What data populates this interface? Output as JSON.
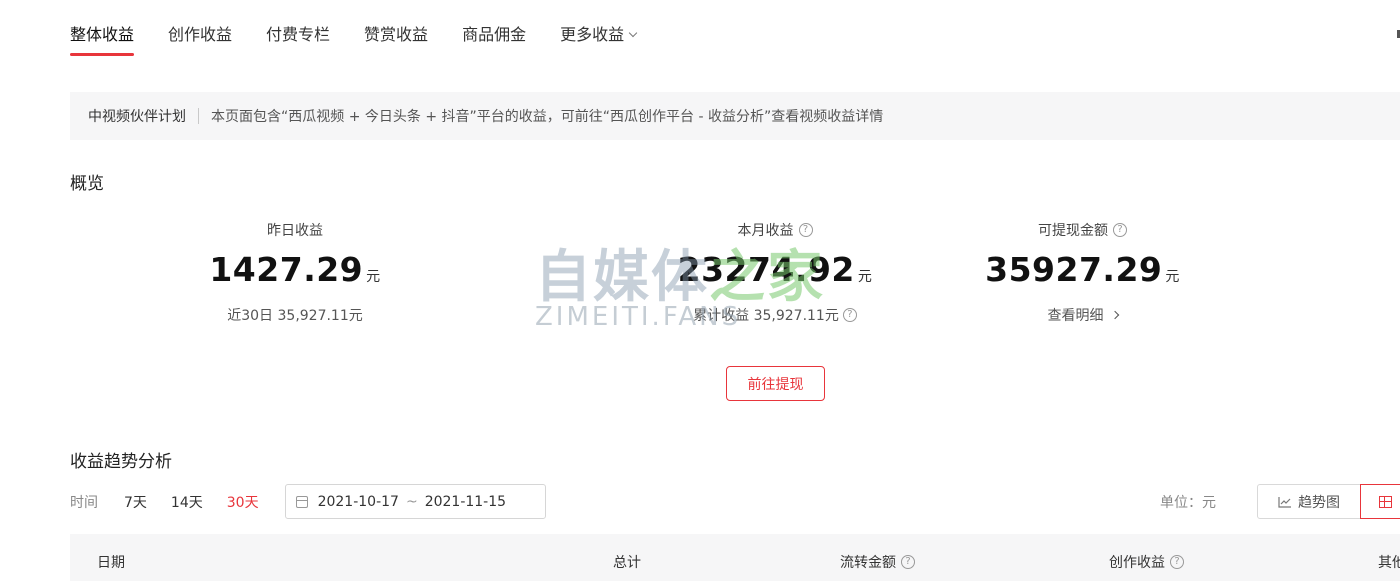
{
  "tabs": [
    "整体收益",
    "创作收益",
    "付费专栏",
    "赞赏收益",
    "商品佣金",
    "更多收益"
  ],
  "notice": {
    "tag": "中视频伙伴计划",
    "text": "本页面包含“西瓜视频 + 今日头条 + 抖音”平台的收益，可前往“西瓜创作平台 - 收益分析”查看视频收益详情"
  },
  "overview": {
    "title": "概览",
    "yesterday": {
      "label": "昨日收益",
      "value": "1427.29",
      "unit": "元",
      "sub": "近30日 35,927.11元"
    },
    "month": {
      "label": "本月收益",
      "value": "23274.92",
      "unit": "元",
      "sub": "累计收益 35,927.11元"
    },
    "withdrawable": {
      "label": "可提现金额",
      "value": "35927.29",
      "unit": "元",
      "sub": "查看明细"
    },
    "withdraw_button": "前往提现"
  },
  "watermark": {
    "main_a": "自媒体",
    "main_b": "之",
    "main_c": "家",
    "sub": "ZIMEITI.FANS"
  },
  "trend": {
    "title": "收益趋势分析",
    "time_label": "时间",
    "ranges": [
      "7天",
      "14天",
      "30天"
    ],
    "active_range": "30天",
    "date_start": "2021-10-17",
    "date_sep": "~",
    "date_end": "2021-11-15",
    "unit": "单位：元",
    "trend_button": "趋势图"
  },
  "table": {
    "headers": [
      "日期",
      "总计",
      "流转金额",
      "创作收益",
      "其他"
    ]
  },
  "colors": {
    "accent": "#e8353b",
    "notice_bg": "#f6f6f7"
  }
}
